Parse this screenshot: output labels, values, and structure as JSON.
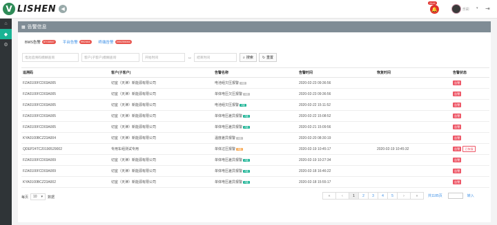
{
  "brand": {
    "name": "LISHEN"
  },
  "header": {
    "alarm_count": "2642",
    "user_name": "乐彩"
  },
  "panel": {
    "title": "告警信息"
  },
  "tabs": [
    {
      "label": "BMS告警",
      "badge": "87/15847"
    },
    {
      "label": "平台告警",
      "badge": "99/2464"
    },
    {
      "label": "终端告警",
      "badge": "395/255084"
    }
  ],
  "filters": {
    "battery_placeholder": "电池追溯码模糊查询",
    "customer_placeholder": "客户(子客户)模糊查询",
    "start_placeholder": "开始时间",
    "end_placeholder": "结束时间",
    "search_label": "搜索",
    "reset_label": "重置"
  },
  "table": {
    "headers": [
      "追溯码",
      "客户(子客户)",
      "告警名称",
      "告警时间",
      "恢复时间",
      "告警状态"
    ],
    "rows": [
      {
        "code": "FZA0100FCD03A005",
        "customer": "切宜（天津）新能源有限公司",
        "alarm": "电池组欠压报警",
        "level": "1级",
        "lv": "lv1",
        "time": "2020-02-23 09:36:56",
        "recover": "",
        "status": "告警",
        "status2": ""
      },
      {
        "code": "FZA0100FCD03A005",
        "customer": "切宜（天津）新能源有限公司",
        "alarm": "单体电压欠压报警",
        "level": "1级",
        "lv": "lv1",
        "time": "2020-02-23 09:36:56",
        "recover": "",
        "status": "告警",
        "status2": ""
      },
      {
        "code": "FZA0100FCD03A005",
        "customer": "切宜（天津）新能源有限公司",
        "alarm": "电池组欠压报警",
        "level": "2级",
        "lv": "lv2",
        "time": "2020-02-22 15:11:52",
        "recover": "",
        "status": "告警",
        "status2": ""
      },
      {
        "code": "FZA0100FCD03A005",
        "customer": "切宜（天津）新能源有限公司",
        "alarm": "单体电压差异报警",
        "level": "2级",
        "lv": "lv2",
        "time": "2020-02-22 15:08:52",
        "recover": "",
        "status": "告警",
        "status2": ""
      },
      {
        "code": "FZA0100FCD03A005",
        "customer": "切宜（天津）新能源有限公司",
        "alarm": "单体电压差异报警",
        "level": "2级",
        "lv": "lv2",
        "time": "2020-02-21 15:09:56",
        "recover": "",
        "status": "告警",
        "status2": ""
      },
      {
        "code": "KYA0100BCZ23A004",
        "customer": "切宜（天津）新能源有限公司",
        "alarm": "温度差异报警",
        "level": "1级",
        "lv": "lv1",
        "time": "2020-02-20 08:30:19",
        "recover": "",
        "status": "告警",
        "status2": ""
      },
      {
        "code": "QDEP24TC20190529002",
        "customer": "专用车组测试专用",
        "alarm": "单体过压报警",
        "level": "3级",
        "lv": "lv3",
        "time": "2020-02-19 10:45:17",
        "recover": "2020-02-19 10:45:32",
        "status": "告警",
        "status2": "已恢复"
      },
      {
        "code": "FZA0100FCD03A009",
        "customer": "切宜（天津）新能源有限公司",
        "alarm": "单体电压差异报警",
        "level": "2级",
        "lv": "lv2",
        "time": "2020-02-19 10:27:34",
        "recover": "",
        "status": "告警",
        "status2": ""
      },
      {
        "code": "FZA0100FCD03A009",
        "customer": "切宜（天津）新能源有限公司",
        "alarm": "单体电压差异报警",
        "level": "2级",
        "lv": "lv2",
        "time": "2020-02-18 16:46:22",
        "recover": "",
        "status": "告警",
        "status2": ""
      },
      {
        "code": "KYA0100BCZ23A002",
        "customer": "切宜（天津）新能源有限公司",
        "alarm": "单体电压差异报警",
        "level": "2级",
        "lv": "lv2",
        "time": "2020-02-18 15:55:17",
        "recover": "",
        "status": "告警",
        "status2": ""
      }
    ]
  },
  "pager": {
    "per_page_label": "每页",
    "per_page_value": "10",
    "per_page_suffix": "数据",
    "first": "«",
    "prev": "‹",
    "pages": [
      "1",
      "2",
      "3",
      "4",
      "5"
    ],
    "next": "›",
    "last": "»",
    "total": "共1185页",
    "goto": "转入"
  }
}
